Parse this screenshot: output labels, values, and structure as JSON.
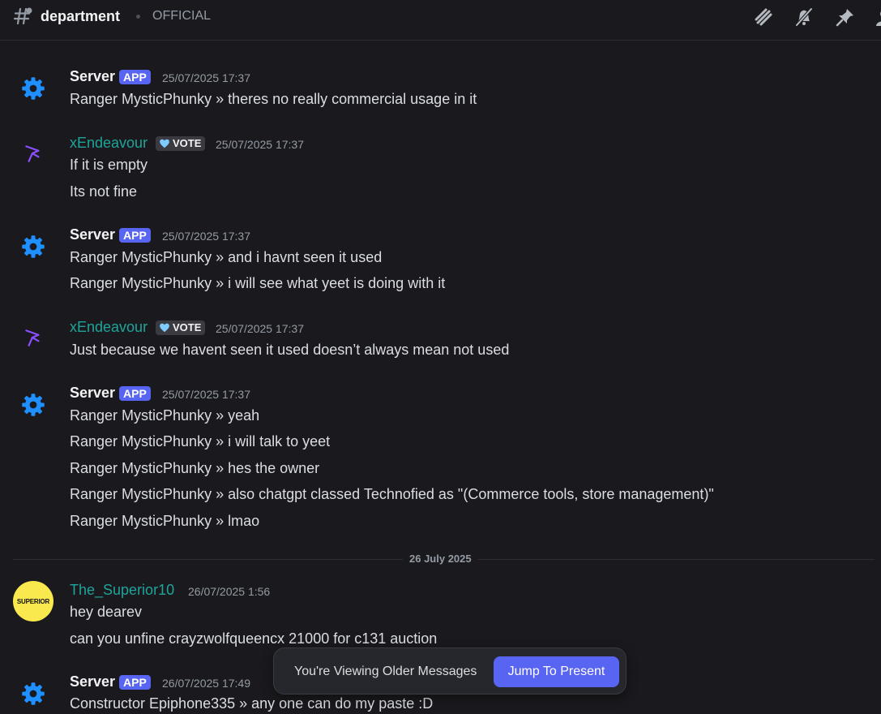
{
  "header": {
    "channel_name": "department",
    "channel_topic": "OFFICIAL",
    "icons": [
      "threads-icon",
      "notification-bell-muted-icon",
      "pin-icon",
      "member-list-icon"
    ]
  },
  "colors": {
    "background": "#1a1a1e",
    "accent": "#5865f2",
    "username_teal": "#1fa49a",
    "gear_blue": "#1e90ff",
    "bird_purple": "#8a4fff",
    "superior_yellow": "#f9e94e"
  },
  "groups": [
    {
      "author": "Server",
      "tag": "APP",
      "timestamp": "25/07/2025 17:37",
      "avatar": "gear-icon",
      "lines": [
        "Ranger MysticPhunky » theres no really commercial usage in it"
      ]
    },
    {
      "author": "xEndeavour",
      "tag": "VOTE",
      "timestamp": "25/07/2025 17:37",
      "avatar": "bird-icon",
      "lines": [
        "If it is empty",
        "Its not fine"
      ]
    },
    {
      "author": "Server",
      "tag": "APP",
      "timestamp": "25/07/2025 17:37",
      "avatar": "gear-icon",
      "lines": [
        "Ranger MysticPhunky » and i havnt seen it used",
        "Ranger MysticPhunky » i will see what yeet is doing with it"
      ]
    },
    {
      "author": "xEndeavour",
      "tag": "VOTE",
      "timestamp": "25/07/2025 17:37",
      "avatar": "bird-icon",
      "lines": [
        "Just because we havent seen it used doesn’t always mean not used"
      ]
    },
    {
      "author": "Server",
      "tag": "APP",
      "timestamp": "25/07/2025 17:37",
      "avatar": "gear-icon",
      "lines": [
        "Ranger MysticPhunky » yeah",
        "Ranger MysticPhunky » i will talk to yeet",
        "Ranger MysticPhunky » hes the owner",
        "Ranger MysticPhunky » also chatgpt classed Technofied as \"(Commerce tools, store management)\"",
        "Ranger MysticPhunky » lmao"
      ]
    },
    {
      "author": "The_Superior10",
      "timestamp": "26/07/2025 1:56",
      "avatar": "superior-avatar",
      "avatar_text": "SUPERIOR",
      "lines": [
        "hey dearev",
        "can you unfine crayzwolfqueencx 21000 for c131 auction"
      ]
    },
    {
      "author": "Server",
      "tag": "APP",
      "timestamp": "26/07/2025 17:49",
      "avatar": "gear-icon",
      "lines": [
        "Constructor Epiphone335 » any one can do my paste :D"
      ]
    }
  ],
  "date_divider": "26 July 2025",
  "banner": {
    "text": "You're Viewing Older Messages",
    "button_label": "Jump To Present"
  }
}
